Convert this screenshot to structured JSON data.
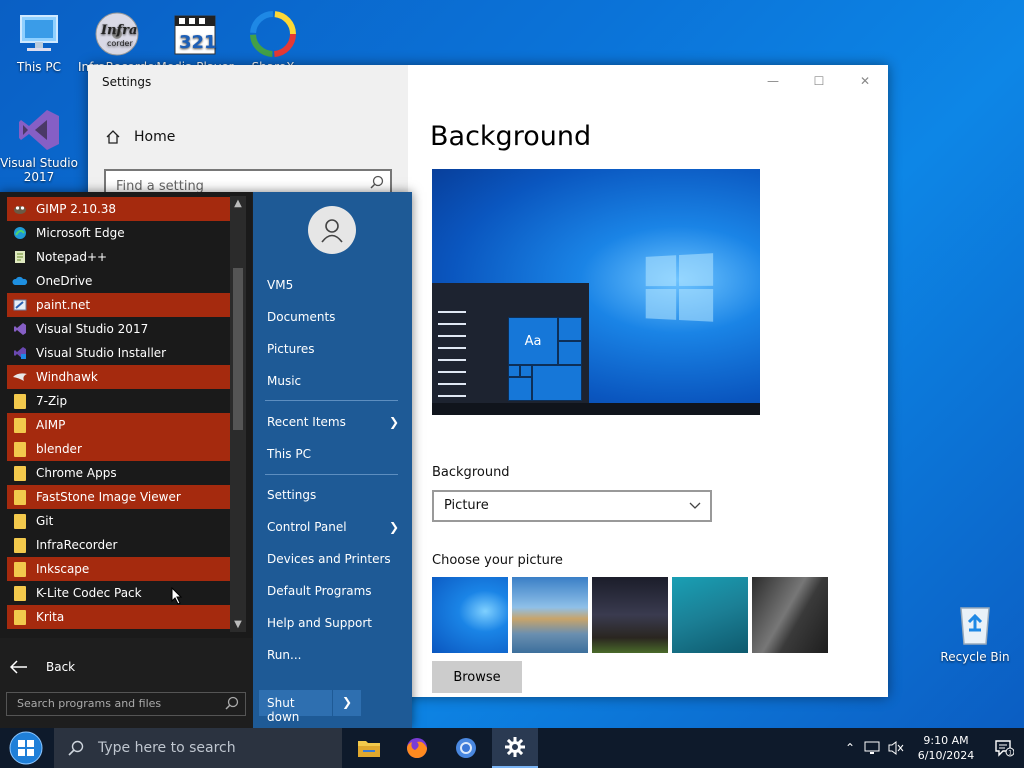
{
  "desktop": {
    "icons": [
      {
        "label": "This PC",
        "icon": "monitor-icon"
      },
      {
        "label": "InfraRecorder",
        "icon": "infrarecorder-icon"
      },
      {
        "label": "Media Player",
        "icon": "media-player-icon"
      },
      {
        "label": "ShareX",
        "icon": "sharex-icon"
      },
      {
        "label": "Visual Studio 2017",
        "icon": "visual-studio-icon"
      },
      {
        "label": "Recycle Bin",
        "icon": "recycle-bin-icon"
      }
    ],
    "infrarecorder_logo_text": "Infra",
    "infrarecorder_logo_sub": "corder",
    "media_player_logo_text": "321"
  },
  "settings": {
    "window_title": "Settings",
    "home_label": "Home",
    "search_placeholder": "Find a setting",
    "page_title": "Background",
    "preview_tile_text": "Aa",
    "background_label": "Background",
    "background_value": "Picture",
    "choose_label": "Choose your picture",
    "browse_label": "Browse",
    "controls": {
      "minimize": "—",
      "maximize": "☐",
      "close": "✕"
    }
  },
  "start_menu": {
    "apps": [
      {
        "label": "GIMP 2.10.38",
        "highlight": true,
        "icon": "gimp-icon"
      },
      {
        "label": "Microsoft Edge",
        "highlight": false,
        "icon": "edge-icon"
      },
      {
        "label": "Notepad++",
        "highlight": false,
        "icon": "notepad-icon"
      },
      {
        "label": "OneDrive",
        "highlight": false,
        "icon": "cloud-icon"
      },
      {
        "label": "paint.net",
        "highlight": true,
        "icon": "paint-icon"
      },
      {
        "label": "Visual Studio 2017",
        "highlight": false,
        "icon": "visual-studio-icon"
      },
      {
        "label": "Visual Studio Installer",
        "highlight": false,
        "icon": "vs-installer-icon"
      },
      {
        "label": "Windhawk",
        "highlight": true,
        "icon": "windhawk-icon"
      },
      {
        "label": "7-Zip",
        "highlight": false,
        "icon": "folder-icon"
      },
      {
        "label": "AIMP",
        "highlight": true,
        "icon": "folder-icon"
      },
      {
        "label": "blender",
        "highlight": true,
        "icon": "folder-icon"
      },
      {
        "label": "Chrome Apps",
        "highlight": false,
        "icon": "folder-icon"
      },
      {
        "label": "FastStone Image Viewer",
        "highlight": true,
        "icon": "folder-icon"
      },
      {
        "label": "Git",
        "highlight": false,
        "icon": "folder-icon"
      },
      {
        "label": "InfraRecorder",
        "highlight": false,
        "icon": "folder-icon"
      },
      {
        "label": "Inkscape",
        "highlight": true,
        "icon": "folder-icon"
      },
      {
        "label": "K-Lite Codec Pack",
        "highlight": false,
        "icon": "folder-icon"
      },
      {
        "label": "Krita",
        "highlight": true,
        "icon": "folder-icon"
      }
    ],
    "back_label": "Back",
    "search_placeholder": "Search programs and files",
    "places": [
      {
        "label": "VM5",
        "arrow": false
      },
      {
        "label": "Documents",
        "arrow": false
      },
      {
        "label": "Pictures",
        "arrow": false
      },
      {
        "label": "Music",
        "arrow": false
      },
      {
        "label": "Recent Items",
        "arrow": true
      },
      {
        "label": "This PC",
        "arrow": false
      },
      {
        "label": "Settings",
        "arrow": false
      },
      {
        "label": "Control Panel",
        "arrow": true
      },
      {
        "label": "Devices and Printers",
        "arrow": false
      },
      {
        "label": "Default Programs",
        "arrow": false
      },
      {
        "label": "Help and Support",
        "arrow": false
      },
      {
        "label": "Run...",
        "arrow": false
      }
    ],
    "shutdown_label": "Shut down",
    "colors": {
      "highlight": "#a52a0e",
      "places_bg": "#1e5a96"
    }
  },
  "taskbar": {
    "search_placeholder": "Type here to search",
    "pinned": [
      "file-explorer-icon",
      "firefox-icon",
      "chrome-icon",
      "settings-gear-icon"
    ],
    "time": "9:10 AM",
    "date": "6/10/2024",
    "notification_count": "1"
  }
}
